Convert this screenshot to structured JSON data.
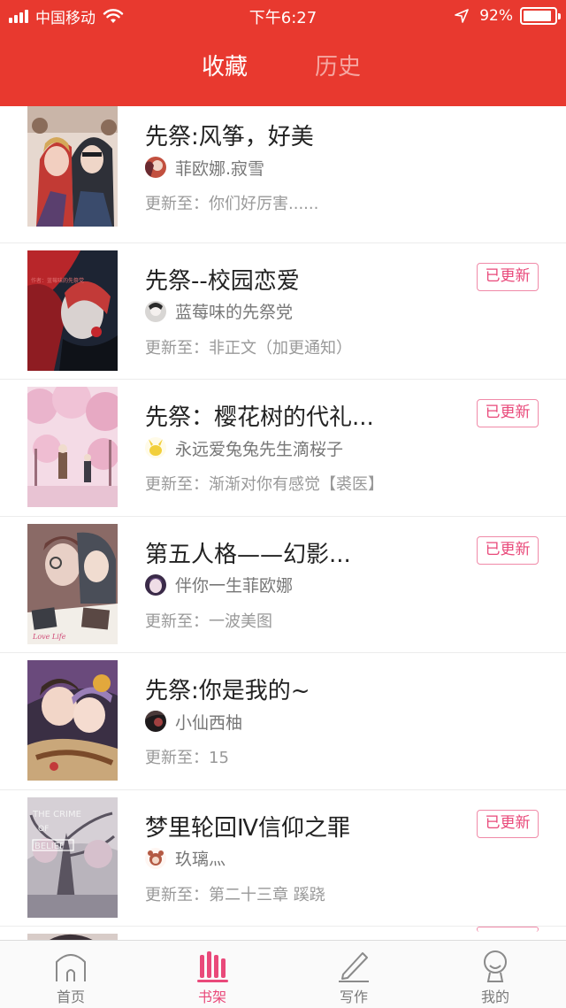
{
  "status_bar": {
    "carrier": "中国移动",
    "time": "下午6:27",
    "battery_percent": "92%",
    "battery_level": 0.92
  },
  "tabs": [
    {
      "label": "收藏",
      "active": true
    },
    {
      "label": "历史",
      "active": false
    }
  ],
  "update_prefix": "更新至：",
  "badge_label": "已更新",
  "books": [
    {
      "title": "先祭:风筝，好美",
      "author": "菲欧娜.寂雪",
      "latest": "你们好厉害......",
      "updated": false
    },
    {
      "title": "先祭--校园恋爱",
      "author": "蓝莓味的先祭党",
      "latest": "非正文（加更通知）",
      "updated": true
    },
    {
      "title": "先祭：樱花树的代礼...",
      "author": "永远爱兔兔先生滴桜子",
      "latest": "渐渐对你有感觉【裘医】",
      "updated": true
    },
    {
      "title": "第五人格——幻影...",
      "author": "伴你一生菲欧娜",
      "latest": "一波美图",
      "updated": true
    },
    {
      "title": "先祭:你是我的~",
      "author": "小仙西柚",
      "latest": "15",
      "updated": false
    },
    {
      "title": "梦里轮回Ⅳ信仰之罪",
      "author": "玖璃灬",
      "latest": "第二十三章 蹊跷",
      "updated": true
    }
  ],
  "cover_texts": {
    "book4": "Love Life",
    "book6_line1": "THE CRIME",
    "book6_line2": "OF",
    "book6_line3": "BELIEF"
  },
  "bottom_nav": [
    {
      "label": "首页",
      "icon": "home-icon",
      "active": false
    },
    {
      "label": "书架",
      "icon": "bookshelf-icon",
      "active": true
    },
    {
      "label": "写作",
      "icon": "pen-icon",
      "active": false
    },
    {
      "label": "我的",
      "icon": "profile-icon",
      "active": false
    }
  ],
  "colors": {
    "header_red": "#e8392f",
    "accent_pink": "#e9497a"
  }
}
